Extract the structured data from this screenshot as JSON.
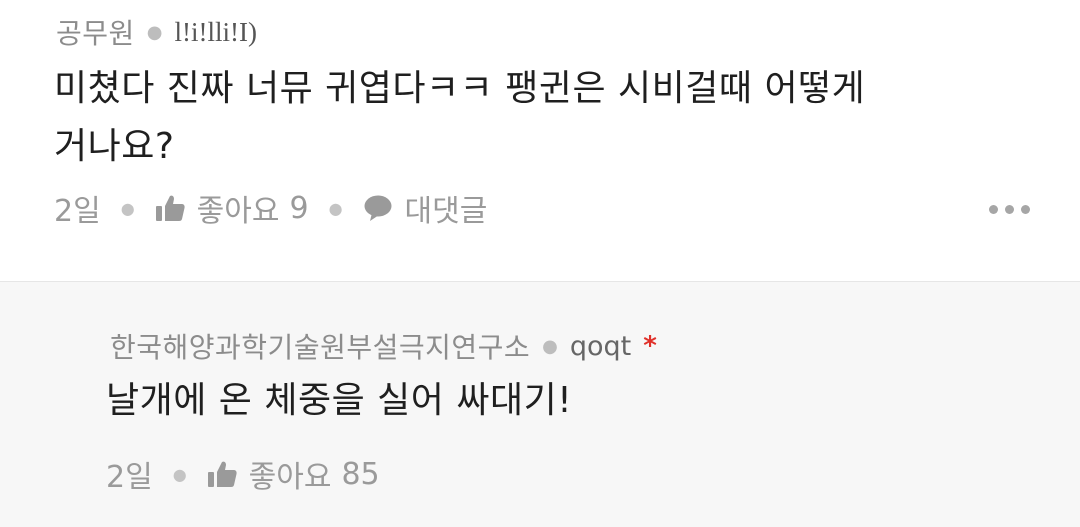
{
  "comment": {
    "author": "공무원",
    "username": "l!i!lli!I)",
    "text_line1": "미쳤다 진짜 너뮤 귀엽다ㅋㅋ 팽귄은 시비걸때 어떻게",
    "text_line2": "거나요?",
    "time": "2일",
    "like_label": "좋아요",
    "like_count": "9",
    "reply_label": "대댓글",
    "more_icon": "more-horizontal-icon"
  },
  "reply": {
    "author": "한국해양과학기술원부설극지연구소",
    "username": "qoqt",
    "badge": "*",
    "text": "날개에 온 체중을 실어 싸대기!",
    "time": "2일",
    "like_label": "좋아요",
    "like_count": "85"
  },
  "colors": {
    "reply_background": "#f7f7f7",
    "badge": "#e0312a",
    "meta_text": "#9a9a9a"
  }
}
